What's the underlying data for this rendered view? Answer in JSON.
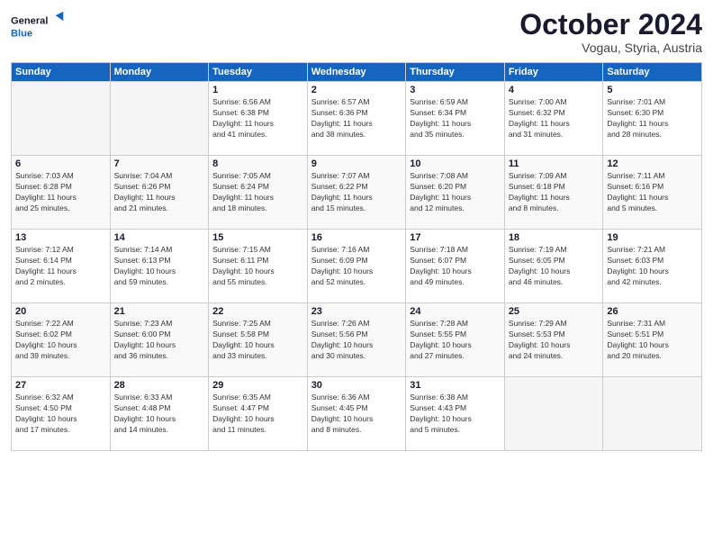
{
  "logo": {
    "line1": "General",
    "line2": "Blue"
  },
  "title": "October 2024",
  "subtitle": "Vogau, Styria, Austria",
  "days_of_week": [
    "Sunday",
    "Monday",
    "Tuesday",
    "Wednesday",
    "Thursday",
    "Friday",
    "Saturday"
  ],
  "weeks": [
    [
      {
        "num": "",
        "info": ""
      },
      {
        "num": "",
        "info": ""
      },
      {
        "num": "1",
        "info": "Sunrise: 6:56 AM\nSunset: 6:38 PM\nDaylight: 11 hours\nand 41 minutes."
      },
      {
        "num": "2",
        "info": "Sunrise: 6:57 AM\nSunset: 6:36 PM\nDaylight: 11 hours\nand 38 minutes."
      },
      {
        "num": "3",
        "info": "Sunrise: 6:59 AM\nSunset: 6:34 PM\nDaylight: 11 hours\nand 35 minutes."
      },
      {
        "num": "4",
        "info": "Sunrise: 7:00 AM\nSunset: 6:32 PM\nDaylight: 11 hours\nand 31 minutes."
      },
      {
        "num": "5",
        "info": "Sunrise: 7:01 AM\nSunset: 6:30 PM\nDaylight: 11 hours\nand 28 minutes."
      }
    ],
    [
      {
        "num": "6",
        "info": "Sunrise: 7:03 AM\nSunset: 6:28 PM\nDaylight: 11 hours\nand 25 minutes."
      },
      {
        "num": "7",
        "info": "Sunrise: 7:04 AM\nSunset: 6:26 PM\nDaylight: 11 hours\nand 21 minutes."
      },
      {
        "num": "8",
        "info": "Sunrise: 7:05 AM\nSunset: 6:24 PM\nDaylight: 11 hours\nand 18 minutes."
      },
      {
        "num": "9",
        "info": "Sunrise: 7:07 AM\nSunset: 6:22 PM\nDaylight: 11 hours\nand 15 minutes."
      },
      {
        "num": "10",
        "info": "Sunrise: 7:08 AM\nSunset: 6:20 PM\nDaylight: 11 hours\nand 12 minutes."
      },
      {
        "num": "11",
        "info": "Sunrise: 7:09 AM\nSunset: 6:18 PM\nDaylight: 11 hours\nand 8 minutes."
      },
      {
        "num": "12",
        "info": "Sunrise: 7:11 AM\nSunset: 6:16 PM\nDaylight: 11 hours\nand 5 minutes."
      }
    ],
    [
      {
        "num": "13",
        "info": "Sunrise: 7:12 AM\nSunset: 6:14 PM\nDaylight: 11 hours\nand 2 minutes."
      },
      {
        "num": "14",
        "info": "Sunrise: 7:14 AM\nSunset: 6:13 PM\nDaylight: 10 hours\nand 59 minutes."
      },
      {
        "num": "15",
        "info": "Sunrise: 7:15 AM\nSunset: 6:11 PM\nDaylight: 10 hours\nand 55 minutes."
      },
      {
        "num": "16",
        "info": "Sunrise: 7:16 AM\nSunset: 6:09 PM\nDaylight: 10 hours\nand 52 minutes."
      },
      {
        "num": "17",
        "info": "Sunrise: 7:18 AM\nSunset: 6:07 PM\nDaylight: 10 hours\nand 49 minutes."
      },
      {
        "num": "18",
        "info": "Sunrise: 7:19 AM\nSunset: 6:05 PM\nDaylight: 10 hours\nand 46 minutes."
      },
      {
        "num": "19",
        "info": "Sunrise: 7:21 AM\nSunset: 6:03 PM\nDaylight: 10 hours\nand 42 minutes."
      }
    ],
    [
      {
        "num": "20",
        "info": "Sunrise: 7:22 AM\nSunset: 6:02 PM\nDaylight: 10 hours\nand 39 minutes."
      },
      {
        "num": "21",
        "info": "Sunrise: 7:23 AM\nSunset: 6:00 PM\nDaylight: 10 hours\nand 36 minutes."
      },
      {
        "num": "22",
        "info": "Sunrise: 7:25 AM\nSunset: 5:58 PM\nDaylight: 10 hours\nand 33 minutes."
      },
      {
        "num": "23",
        "info": "Sunrise: 7:26 AM\nSunset: 5:56 PM\nDaylight: 10 hours\nand 30 minutes."
      },
      {
        "num": "24",
        "info": "Sunrise: 7:28 AM\nSunset: 5:55 PM\nDaylight: 10 hours\nand 27 minutes."
      },
      {
        "num": "25",
        "info": "Sunrise: 7:29 AM\nSunset: 5:53 PM\nDaylight: 10 hours\nand 24 minutes."
      },
      {
        "num": "26",
        "info": "Sunrise: 7:31 AM\nSunset: 5:51 PM\nDaylight: 10 hours\nand 20 minutes."
      }
    ],
    [
      {
        "num": "27",
        "info": "Sunrise: 6:32 AM\nSunset: 4:50 PM\nDaylight: 10 hours\nand 17 minutes."
      },
      {
        "num": "28",
        "info": "Sunrise: 6:33 AM\nSunset: 4:48 PM\nDaylight: 10 hours\nand 14 minutes."
      },
      {
        "num": "29",
        "info": "Sunrise: 6:35 AM\nSunset: 4:47 PM\nDaylight: 10 hours\nand 11 minutes."
      },
      {
        "num": "30",
        "info": "Sunrise: 6:36 AM\nSunset: 4:45 PM\nDaylight: 10 hours\nand 8 minutes."
      },
      {
        "num": "31",
        "info": "Sunrise: 6:38 AM\nSunset: 4:43 PM\nDaylight: 10 hours\nand 5 minutes."
      },
      {
        "num": "",
        "info": ""
      },
      {
        "num": "",
        "info": ""
      }
    ]
  ]
}
